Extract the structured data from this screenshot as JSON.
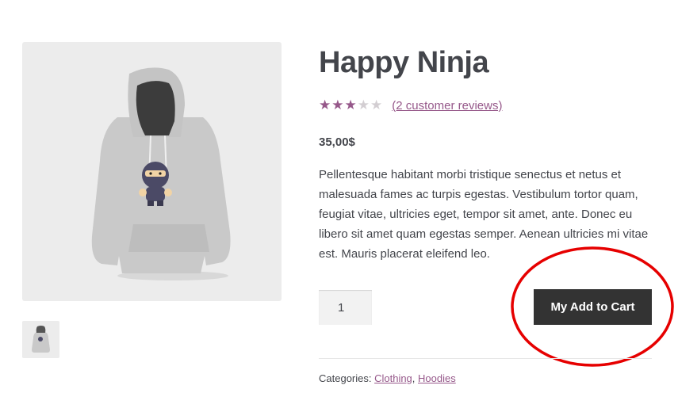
{
  "product": {
    "title": "Happy Ninja",
    "rating": 3,
    "rating_max": 5,
    "reviews_label": "(2 customer reviews)",
    "price": "35,00$",
    "description": "Pellentesque habitant morbi tristique senectus et netus et malesuada fames ac turpis egestas. Vestibulum tortor quam, feugiat vitae, ultricies eget, tempor sit amet, ante. Donec eu libero sit amet quam egestas semper. Aenean ultricies mi vitae est. Mauris placerat eleifend leo.",
    "quantity": "1",
    "add_to_cart_label": "My Add to Cart",
    "categories_label": "Categories:",
    "categories": [
      "Clothing",
      "Hoodies"
    ],
    "categories_separator": ", "
  },
  "colors": {
    "accent": "#96588a",
    "button_bg": "#333333",
    "annotation": "#e60000"
  },
  "icons": {
    "star": "star-icon",
    "annotation": "red-circle-annotation"
  }
}
